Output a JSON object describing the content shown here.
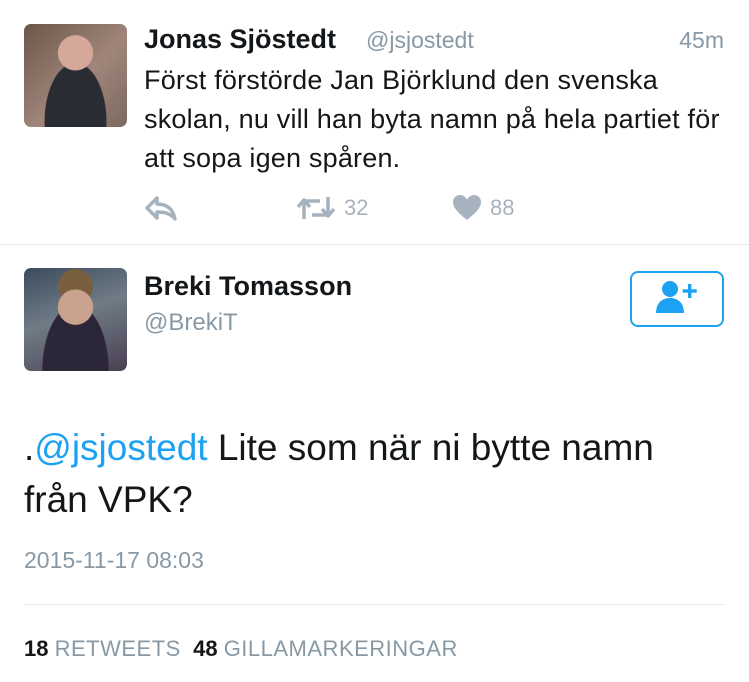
{
  "colors": {
    "accent": "#1da1f2",
    "secondary_text": "#8899a6",
    "icon_gray": "#a6b3be",
    "primary_text": "#14171a",
    "divider": "#e1e8ed"
  },
  "parent_tweet": {
    "author_name": "Jonas Sjöstedt",
    "author_handle": "@jsjostedt",
    "timestamp": "45m",
    "text": "Först förstörde Jan Björklund den svenska skolan, nu vill han byta namn på hela partiet för att sopa igen spåren.",
    "actions": {
      "reply_icon": "reply-icon",
      "retweet_icon": "retweet-icon",
      "retweet_count": "32",
      "like_icon": "heart-icon",
      "like_count": "88"
    }
  },
  "main_tweet": {
    "author_name": "Breki Tomasson",
    "author_handle": "@BrekiT",
    "follow_icon": "follow-user-icon",
    "text_prefix": ".",
    "mention": "@jsjostedt",
    "text_body": " Lite som när ni bytte namn från VPK?",
    "date": "2015-11-17 08:03",
    "stats": {
      "retweets_count": "18",
      "retweets_label": "RETWEETS",
      "likes_count": "48",
      "likes_label": "GILLAMARKERINGAR"
    }
  }
}
